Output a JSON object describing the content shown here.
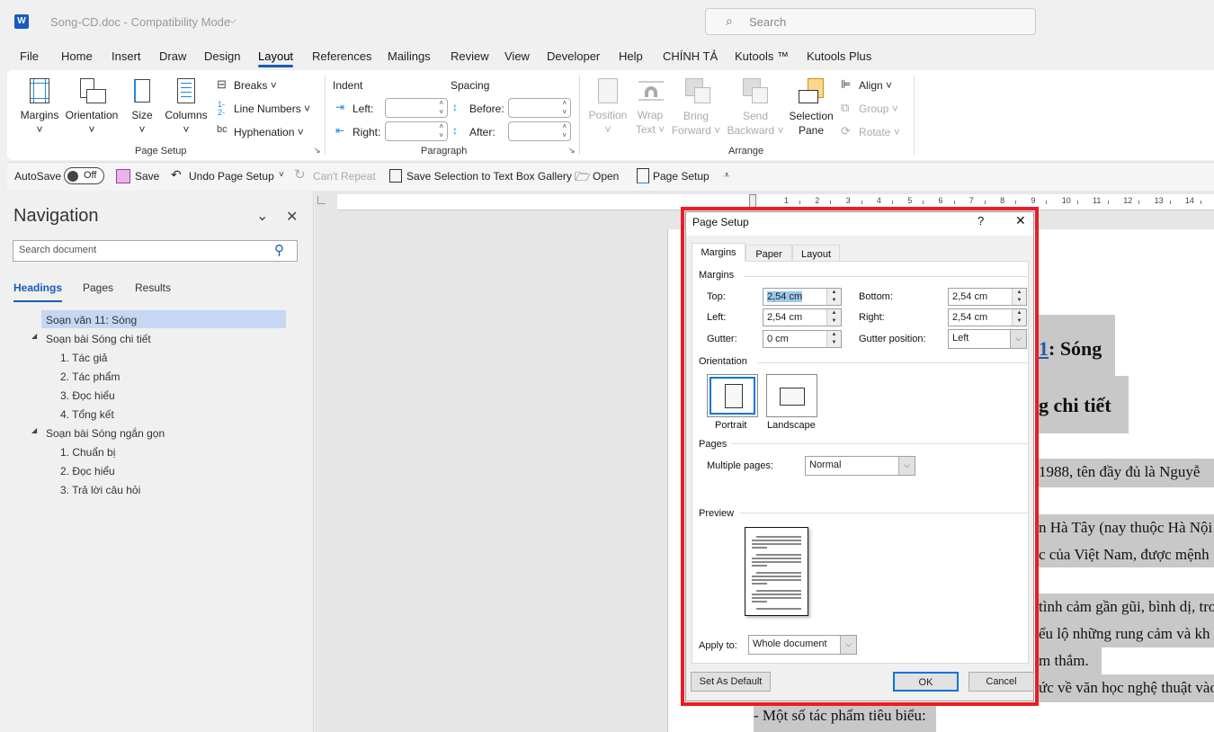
{
  "titlebar": {
    "doc_title": "Song-CD.doc  -  Compatibility Mode",
    "search_placeholder": "Search"
  },
  "tabs": [
    "File",
    "Home",
    "Insert",
    "Draw",
    "Design",
    "Layout",
    "References",
    "Mailings",
    "Review",
    "View",
    "Developer",
    "Help",
    "CHÍNH TẢ",
    "Kutools ™",
    "Kutools Plus"
  ],
  "active_tab": "Layout",
  "ribbon": {
    "page_setup": {
      "margins": "Margins",
      "orientation": "Orientation",
      "size": "Size",
      "columns": "Columns",
      "breaks": "Breaks",
      "line_numbers": "Line Numbers",
      "hyphenation": "Hyphenation",
      "group": "Page Setup"
    },
    "paragraph": {
      "indent": "Indent",
      "spacing": "Spacing",
      "left": "Left:",
      "right": "Right:",
      "before": "Before:",
      "after": "After:",
      "group": "Paragraph"
    },
    "arrange": {
      "position": "Position",
      "wrap1": "Wrap",
      "wrap2": "Text",
      "bring1": "Bring",
      "bring2": "Forward",
      "send1": "Send",
      "send2": "Backward",
      "sel1": "Selection",
      "sel2": "Pane",
      "align": "Align",
      "groupbtn": "Group",
      "rotate": "Rotate",
      "group": "Arrange"
    }
  },
  "qat": {
    "autosave": "AutoSave",
    "off": "Off",
    "save": "Save",
    "undo": "Undo Page Setup",
    "repeat": "Can't Repeat",
    "save_sel": "Save Selection to Text Box Gallery",
    "open": "Open",
    "page_setup": "Page Setup"
  },
  "navigation": {
    "title": "Navigation",
    "search_placeholder": "Search document",
    "tabs": [
      "Headings",
      "Pages",
      "Results"
    ],
    "headings": [
      {
        "text": "Soạn văn 11: Sóng",
        "level": 0,
        "selected": true
      },
      {
        "text": "Soạn bài Sóng chi tiết",
        "level": 1
      },
      {
        "text": "1. Tác giả",
        "level": 2
      },
      {
        "text": "2. Tác phẩm",
        "level": 2
      },
      {
        "text": "3. Đọc hiểu",
        "level": 2
      },
      {
        "text": "4. Tổng kết",
        "level": 2
      },
      {
        "text": "Soạn bài Sóng ngắn gọn",
        "level": 1
      },
      {
        "text": "1. Chuẩn bị",
        "level": 2
      },
      {
        "text": "2. Đọc hiểu",
        "level": 2
      },
      {
        "text": "3. Trả lời câu hỏi",
        "level": 2
      }
    ]
  },
  "ruler": [
    "1",
    "2",
    "3",
    "4",
    "5",
    "6",
    "7",
    "8",
    "9",
    "10",
    "11",
    "12",
    "13",
    "14"
  ],
  "document": {
    "h1a": "1",
    "h1b": ": Sóng",
    "h2": "g chi tiết",
    "lines": [
      "1988, tên đầy đủ là Nguyễ",
      "n Hà Tây (nay thuộc Hà Nội",
      "c của Việt Nam, được mệnh",
      "tình cảm gần gũi, bình dị, tro",
      "ểu lộ những rung cảm và kh",
      "m thắm.",
      "ức về văn học nghệ thuật vào",
      "- Một số tác phẩm tiêu biểu:"
    ]
  },
  "dialog": {
    "title": "Page Setup",
    "help": "?",
    "tabs": [
      "Margins",
      "Paper",
      "Layout"
    ],
    "margins_section": "Margins",
    "top_label": "Top:",
    "top": "2,54 cm",
    "bottom_label": "Bottom:",
    "bottom": "2,54 cm",
    "left_label": "Left:",
    "left": "2,54 cm",
    "right_label": "Right:",
    "right": "2,54 cm",
    "gutter_label": "Gutter:",
    "gutter": "0 cm",
    "gutter_pos_label": "Gutter position:",
    "gutter_pos": "Left",
    "orientation_section": "Orientation",
    "portrait": "Portrait",
    "landscape": "Landscape",
    "selected_orientation": "Portrait",
    "pages_section": "Pages",
    "multiple_pages_label": "Multiple pages:",
    "multiple_pages": "Normal",
    "preview_section": "Preview",
    "apply_to_label": "Apply to:",
    "apply_to": "Whole document",
    "set_default": "Set As Default",
    "ok": "OK",
    "cancel": "Cancel"
  },
  "colors": {
    "accent": "#1a5bb5",
    "highlight_box": "#ea1c24",
    "text_highlight": "#c8c8c8",
    "nav_selected": "#c5d7f2"
  }
}
